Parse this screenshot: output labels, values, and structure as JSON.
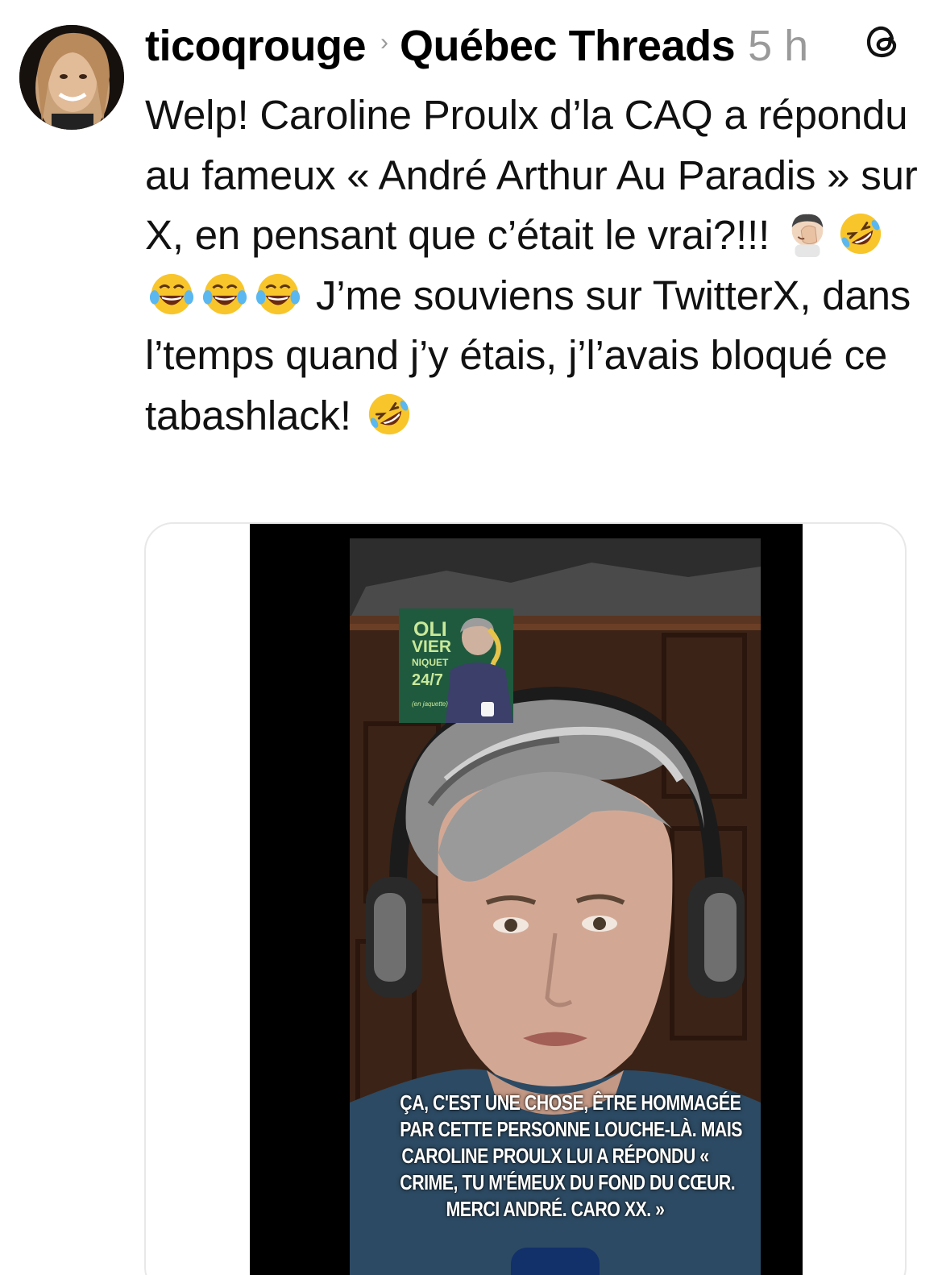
{
  "post": {
    "author": "ticoqrouge",
    "separator_icon": "chevron-right-icon",
    "community": "Québec Threads",
    "time": "5 h",
    "app_icon": "threads-logo-icon",
    "text": {
      "part1": "Welp! Caroline Proulx d’la CAQ a répondu au fameux « André Arthur Au Paradis » sur X, en pensant que c’était le vrai?!!! ",
      "part2": " J’me souviens sur TwitterX, dans l’temps quand j’y étais, j’l’avais bloqué ce tabashlack! ",
      "emojis_1": [
        "facepalm-emoji",
        "rolling-on-floor-laughing-emoji",
        "tears-of-joy-emoji",
        "tears-of-joy-emoji",
        "tears-of-joy-emoji"
      ],
      "emojis_2": [
        "rolling-on-floor-laughing-emoji"
      ]
    }
  },
  "media": {
    "type": "video",
    "book": {
      "line1": "OLI",
      "line2": "VIER",
      "line3": "NIQUET",
      "line4": "24/7",
      "line5": "(en jaquette)"
    },
    "caption": [
      "ÇA, C'EST UNE CHOSE, ÊTRE HOMMAGÉE",
      "PAR CETTE PERSONNE LOUCHE-LÀ. MAIS",
      "CAROLINE PROULX LUI A RÉPONDU «",
      "CRIME, TU M'ÉMEUX DU FOND DU CŒUR.",
      "MERCI ANDRÉ. CARO XX. »"
    ]
  },
  "colors": {
    "text": "#111111",
    "muted": "#9a9a9a",
    "card_border": "#e8e8e8",
    "video_bg": "#000000",
    "book_green": "#1f5a3e"
  }
}
